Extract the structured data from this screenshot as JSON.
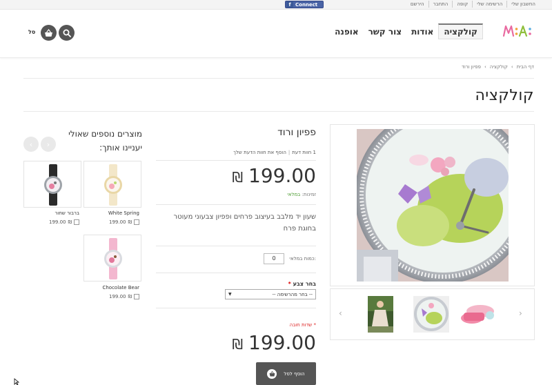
{
  "topbar": {
    "links": [
      "החשבון שלי",
      "הרשימה שלי",
      "קופה",
      "התחבר",
      "הירשם"
    ],
    "connect_label": "Connect"
  },
  "header": {
    "logo": "m:a:",
    "nav": [
      "קולקציה",
      "אודות",
      "צור קשר",
      "אופנה"
    ],
    "cart_label": "סל"
  },
  "breadcrumb": [
    "דף הבית",
    "קולקציה",
    "פפיון ורוד"
  ],
  "page_title": "קולקציה",
  "product": {
    "name": "פפיון ורוד",
    "review_count": "1 חוות דעת",
    "add_review": "הוסף את חוות הדעת שלך",
    "price": "199.00",
    "currency": "₪",
    "availability_label": "זמינות:",
    "availability_value": "במלאי",
    "description": "שעון יד מלבב בעיצוב פרחים ופפיון צבעוני מעוטר בחוגת פרח",
    "qty_label": "כמות במלאי:",
    "qty_value": "0",
    "color_label": "בחר צבע",
    "required_mark": "*",
    "select_placeholder": "-- בחר מהרשימה --",
    "required_note": "* שדות חובה",
    "add_to_cart": "הוסף לסל"
  },
  "related": {
    "title": "מוצרים נוספים שאולי יעניינו אותך:",
    "items": [
      {
        "name": "White Spring",
        "price": "199.00",
        "currency": "₪"
      },
      {
        "name": "ברבור שחור",
        "price": "199.00",
        "currency": "₪"
      },
      {
        "name": "Chocolate Bear",
        "price": "199.00",
        "currency": "₪"
      }
    ]
  },
  "colors": {
    "accent": "#555555",
    "in_stock": "#4a9b2f",
    "required": "#dd2222",
    "facebook": "#3b5998"
  }
}
